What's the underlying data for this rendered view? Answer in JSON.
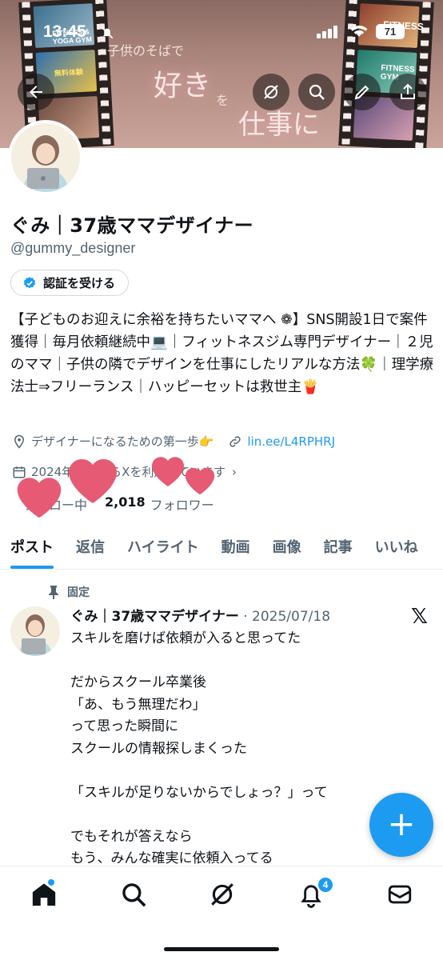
{
  "status_bar": {
    "time": "13:45",
    "battery": "71"
  },
  "banner": {
    "subtitle": "子供のそばで",
    "headline_1": "好き",
    "headline_particle": "を",
    "headline_2": "仕事に",
    "film_left_label_1": "FITNESS & YOGA GYM",
    "film_left_label_2": "無料体験",
    "film_right_label_1": "FITNESS",
    "film_right_label_2": "FITNESS GYM"
  },
  "profile": {
    "name": "ぐみ｜37歳ママデザイナー",
    "handle": "@gummy_designer",
    "verify_label": "認証を受ける",
    "bio": "【子どものお迎えに余裕を持ちたいママへ ❁】SNS開設1日で案件獲得｜毎月依頼継続中💻｜フィットネスジム専門デザイナー｜２児のママ｜子供の隣でデザインを仕事にしたリアルな方法🍀｜理学療法士⇒フリーランス｜ハッピーセットは救世主🍟",
    "location": "デザイナーになるための第一歩👉",
    "link": "lin.ee/L4RPHRJ",
    "joined": "2024年　　からXを利用しています",
    "following_label": "フォロー中",
    "followers_count": "2,018",
    "followers_label": "フォロワー"
  },
  "tabs": [
    {
      "label": "ポスト",
      "active": true
    },
    {
      "label": "返信",
      "active": false
    },
    {
      "label": "ハイライト",
      "active": false
    },
    {
      "label": "動画",
      "active": false
    },
    {
      "label": "画像",
      "active": false
    },
    {
      "label": "記事",
      "active": false
    },
    {
      "label": "いいね",
      "active": false
    }
  ],
  "pinned_tweet": {
    "pinned_label": "固定",
    "author": "ぐみ｜37歳ママデザイナー",
    "date": "· 2025/07/18",
    "text": "スキルを磨けば依頼が入ると思ってた\n\nだからスクール卒業後\n「あ、もう無理だわ」\nって思った瞬間に\nスクールの情報探しまくった\n\n「スキルが足りないからでしょっ？」って\n\nでもそれが答えなら\nもう、みんな確実に依頼入ってる"
  },
  "fab": {
    "label": "+"
  },
  "bottom_nav": {
    "notification_count": "4"
  },
  "colors": {
    "accent": "#1d9bf0",
    "heart": "#e65a74",
    "text": "#0f1419",
    "muted": "#536471"
  }
}
